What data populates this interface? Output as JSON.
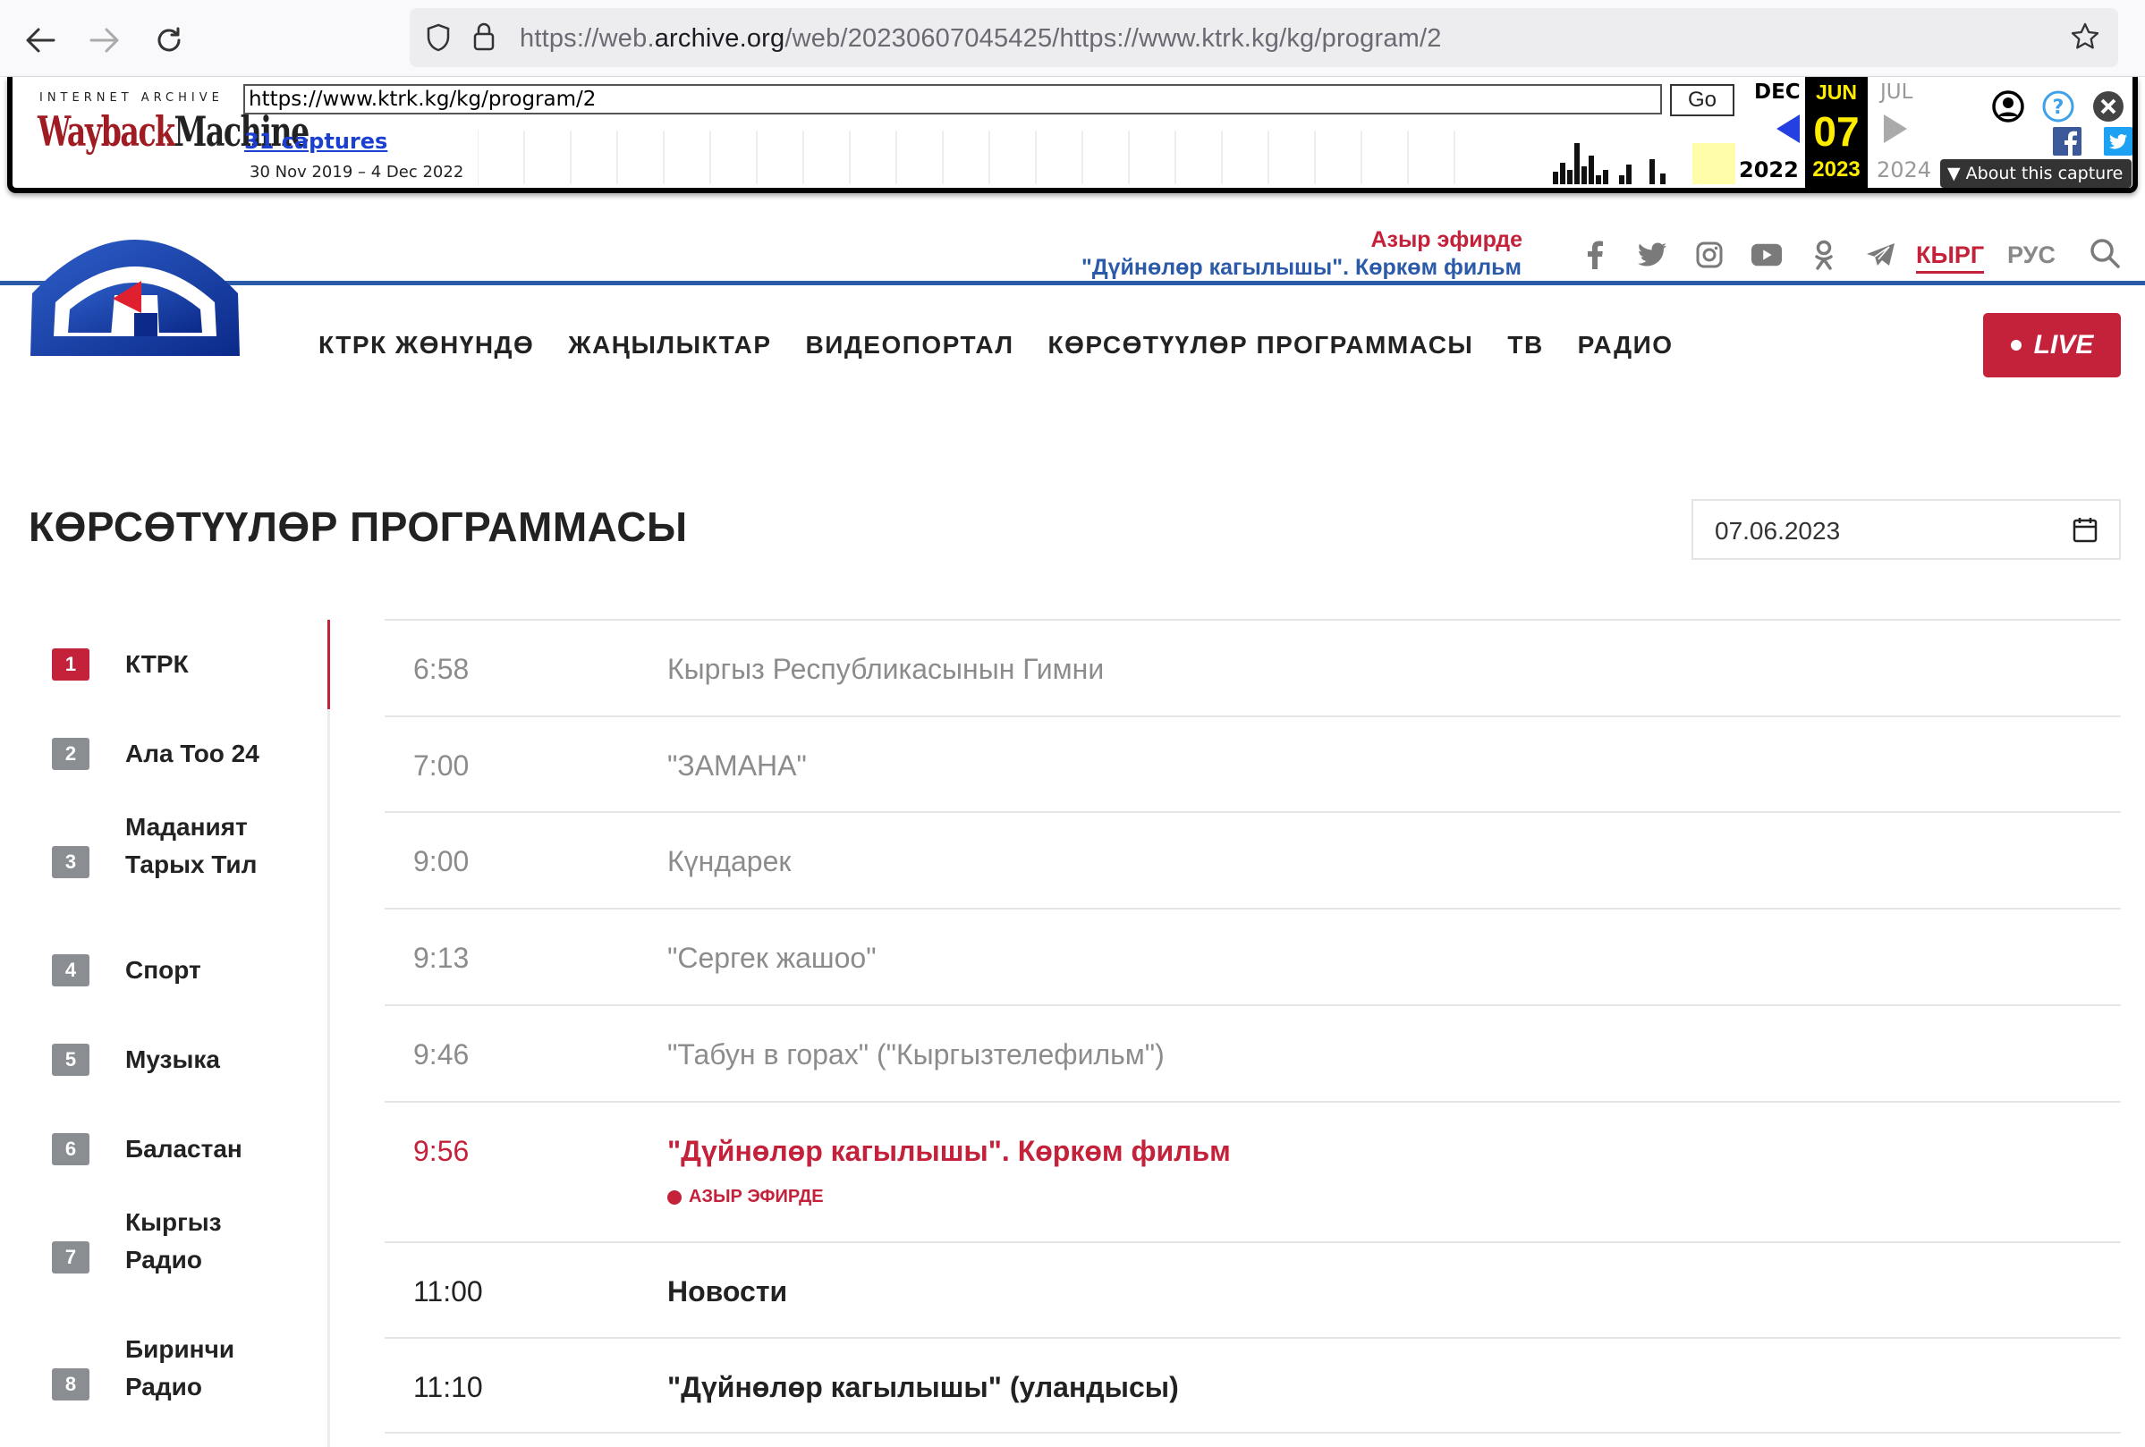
{
  "browser": {
    "url_prefix": "https://web.",
    "url_domain": "archive.org",
    "url_rest": "/web/20230607045425/https://www.ktrk.kg/kg/program/2"
  },
  "wayback": {
    "ia_label": "INTERNET ARCHIVE",
    "logo_a": "Wayback",
    "logo_b": "Machine",
    "url_value": "https://www.ktrk.kg/kg/program/2",
    "go_label": "Go",
    "captures_label": "31 captures",
    "range_label": "30 Nov 2019 – 4 Dec 2022",
    "prev_month": "DEC",
    "cur_month": "JUN",
    "next_month": "JUL",
    "cur_day": "07",
    "prev_year": "2022",
    "cur_year": "2023",
    "next_year": "2024",
    "about_label": "About this capture"
  },
  "header": {
    "live_label": "Азыр эфирде",
    "live_show": "\"Дүйнөлөр кагылышы\". Көркөм фильм",
    "socials": [
      "facebook-icon",
      "twitter-icon",
      "instagram-icon",
      "youtube-icon",
      "odnoklassniki-icon",
      "telegram-icon"
    ],
    "lang_ky": "КЫРГ",
    "lang_ru": "РУС"
  },
  "nav": {
    "items": [
      "КТРК ЖӨНҮНДӨ",
      "ЖАҢЫЛЫКТАР",
      "ВИДЕОПОРТАЛ",
      "КӨРСӨТҮҮЛӨР ПРОГРАММАСЫ",
      "ТВ",
      "РАДИО"
    ],
    "live_button": "LIVE"
  },
  "page": {
    "title": "КӨРСӨТҮҮЛӨР ПРОГРАММАСЫ",
    "date": "07.06.2023"
  },
  "channels": [
    {
      "num": "1",
      "name": "КТРК"
    },
    {
      "num": "2",
      "name": "Ала Тоо 24"
    },
    {
      "num": "3",
      "name": "Маданият Тарых Тил"
    },
    {
      "num": "4",
      "name": "Спорт"
    },
    {
      "num": "5",
      "name": "Музыка"
    },
    {
      "num": "6",
      "name": "Баластан"
    },
    {
      "num": "7",
      "name": "Кыргыз Радио"
    },
    {
      "num": "8",
      "name": "Биринчи Радио"
    }
  ],
  "programs": [
    {
      "time": "6:58",
      "name": "Кыргыз Республикасынын Гимни"
    },
    {
      "time": "7:00",
      "name": "\"ЗАМАНА\""
    },
    {
      "time": "9:00",
      "name": "Күндарек"
    },
    {
      "time": "9:13",
      "name": "\"Сергек жашоо\""
    },
    {
      "time": "9:46",
      "name": "\"Табун в горах\" (\"Кыргызтелефильм\")"
    },
    {
      "time": "9:56",
      "name": "\"Дүйнөлөр кагылышы\". Көркөм фильм",
      "status": "АЗЫР ЭФИРДЕ"
    },
    {
      "time": "11:00",
      "name": "Новости"
    },
    {
      "time": "11:10",
      "name": "\"Дүйнөлөр кагылышы\" (уландысы)"
    }
  ],
  "colors": {
    "accent_red": "#c4213a",
    "accent_blue": "#2a5aa8"
  }
}
